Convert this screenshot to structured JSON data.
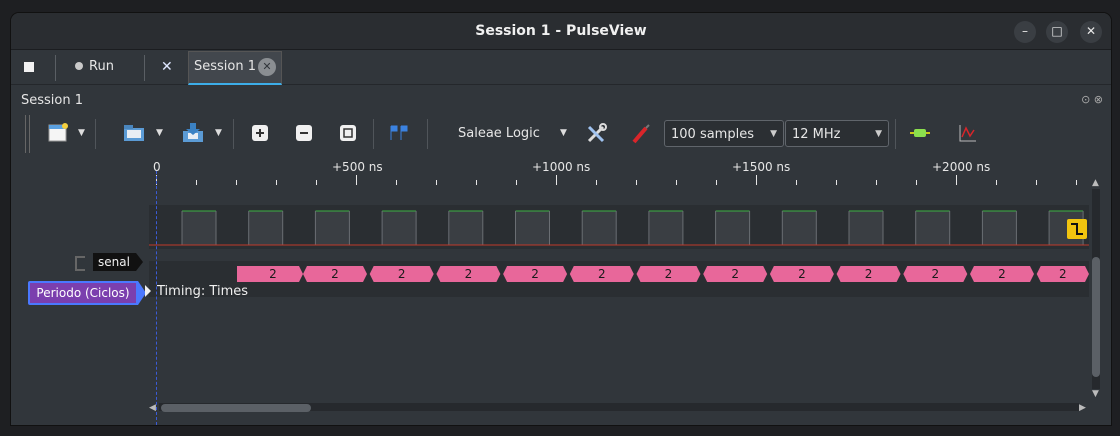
{
  "window": {
    "title": "Session 1 - PulseView",
    "minimize": "–",
    "maximize": "□",
    "close": "✕"
  },
  "tabbar": {
    "run_label": "Run",
    "session_tab": "Session 1"
  },
  "panel": {
    "title": "Session 1"
  },
  "toolbar": {
    "device": "Saleae Logic",
    "samples": "100  samples",
    "samplerate": "12 MHz"
  },
  "ruler": {
    "labels": [
      {
        "text": "0",
        "t": 0
      },
      {
        "text": "+500 ns",
        "t": 500
      },
      {
        "text": "+1000 ns",
        "t": 1000
      },
      {
        "text": "+1500 ns",
        "t": 1500
      },
      {
        "text": "+2000 ns",
        "t": 2000
      }
    ]
  },
  "channels": {
    "digital_label": "senal",
    "decoder_label": "Periodo (Ciclos)",
    "decoder_row": "Timing: Times"
  },
  "decoder": {
    "annotation_value": "2",
    "annotation_count": 13,
    "color": "#e8679a"
  },
  "colors": {
    "accent": "#3daee9",
    "high": "#3cb043",
    "low": "#c0392b",
    "decoder_label": "#7b3fae"
  }
}
